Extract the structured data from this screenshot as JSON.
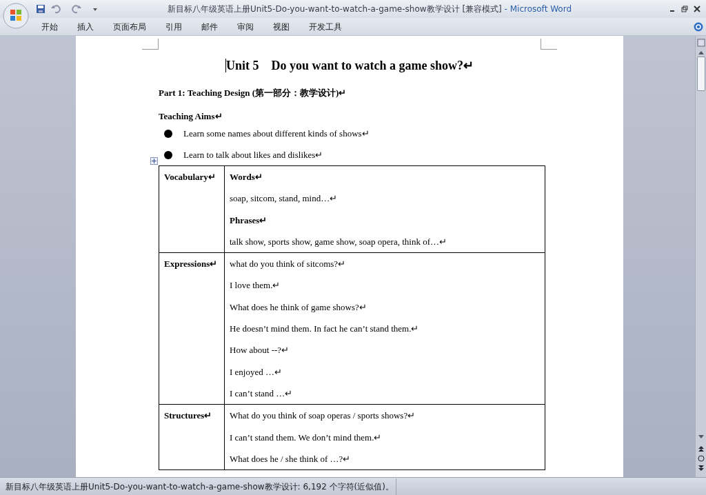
{
  "window": {
    "title": "新目标八年级英语上册Unit5-Do-you-want-to-watch-a-game-show教学设计 [兼容模式]",
    "app": " - Microsoft Word"
  },
  "ribbon_tabs": [
    {
      "label": "开始"
    },
    {
      "label": "插入"
    },
    {
      "label": "页面布局"
    },
    {
      "label": "引用"
    },
    {
      "label": "邮件"
    },
    {
      "label": "审阅"
    },
    {
      "label": "视图"
    },
    {
      "label": "开发工具"
    }
  ],
  "document": {
    "title": "Unit 5    Do you want to watch a game show?↵",
    "part": "Part 1: Teaching Design (第一部分：教学设计)↵",
    "heading": "Teaching Aims↵",
    "bullets": [
      "Learn some names about different kinds of shows↵",
      "Learn to talk about likes and dislikes↵"
    ],
    "table": {
      "rows": [
        {
          "header": "Vocabulary↵",
          "lines": [
            {
              "text": "Words↵",
              "bold": true
            },
            {
              "text": "soap, sitcom, stand, mind…↵",
              "bold": false
            },
            {
              "text": "Phrases↵",
              "bold": true
            },
            {
              "text": "talk show, sports show, game show, soap opera, think of…↵",
              "bold": false
            }
          ]
        },
        {
          "header": "Expressions↵",
          "lines": [
            {
              "text": "what do you think of sitcoms?↵",
              "bold": false
            },
            {
              "text": "I love them.↵",
              "bold": false
            },
            {
              "text": "What does he think of game shows?↵",
              "bold": false
            },
            {
              "text": "He doesn’t mind them. In fact he can’t stand them.↵",
              "bold": false
            },
            {
              "text": "How about --?↵",
              "bold": false
            },
            {
              "text": "I enjoyed …↵",
              "bold": false
            },
            {
              "text": "I can’t stand …↵",
              "bold": false
            }
          ]
        },
        {
          "header": "Structures↵",
          "lines": [
            {
              "text": "What do you think of soap operas / sports shows?↵",
              "bold": false
            },
            {
              "text": "I can’t stand them. We don’t mind them.↵",
              "bold": false
            },
            {
              "text": "What does he / she think of …?↵",
              "bold": false
            }
          ]
        }
      ]
    }
  },
  "status_bar": {
    "text": "新目标八年级英语上册Unit5-Do-you-want-to-watch-a-game-show教学设计: 6,192 个字符(近似值)。"
  }
}
